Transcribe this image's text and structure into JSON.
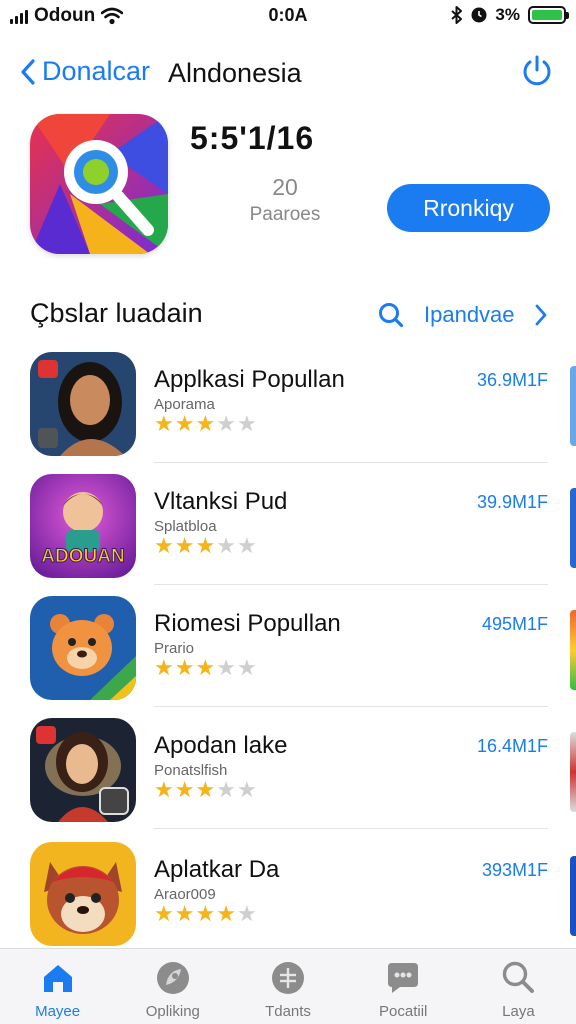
{
  "status_bar": {
    "carrier": "Odoun",
    "time": "0:0A",
    "battery": "3%",
    "battery_level": 1.0
  },
  "nav": {
    "back_label": "Donalcar",
    "title": "Alndonesia"
  },
  "hero": {
    "title": "5:5'1/16",
    "rating": "20",
    "rating_label": "Paaroes",
    "button_label": "Rronkiqy"
  },
  "section": {
    "title": "Çbslar luadain",
    "link_label": "Ipandvae"
  },
  "apps": [
    {
      "name": "Applkasi Popullan",
      "subtitle": "Aporama",
      "rating": 3,
      "size": "36.9M1F"
    },
    {
      "name": "Vltanksi Pud",
      "subtitle": "Splatbloa",
      "rating": 3,
      "size": "39.9M1F"
    },
    {
      "name": "Riomesi Popullan",
      "subtitle": "Prario",
      "rating": 3,
      "size": "495M1F"
    },
    {
      "name": "Apodan lake",
      "subtitle": "Ponatslfish",
      "rating": 3,
      "size": "16.4M1F"
    },
    {
      "name": "Aplatkar Da",
      "subtitle": "Araor009",
      "rating": 4,
      "size": "393M1F"
    }
  ],
  "icon_texts": {
    "app2_badge": "ADOUAN"
  },
  "tabs": [
    {
      "label": "Mayee",
      "icon": "home-icon",
      "active": true
    },
    {
      "label": "Opliking",
      "icon": "rocket-icon",
      "active": false
    },
    {
      "label": "Tdants",
      "icon": "apps-icon",
      "active": false
    },
    {
      "label": "Pocatiil",
      "icon": "chat-icon",
      "active": false
    },
    {
      "label": "Laya",
      "icon": "search-icon",
      "active": false
    }
  ],
  "colors": {
    "accent": "#1a7cf0",
    "star": "#f4b41a",
    "star_off": "#cfcfcf",
    "battery": "#2fc24b"
  }
}
